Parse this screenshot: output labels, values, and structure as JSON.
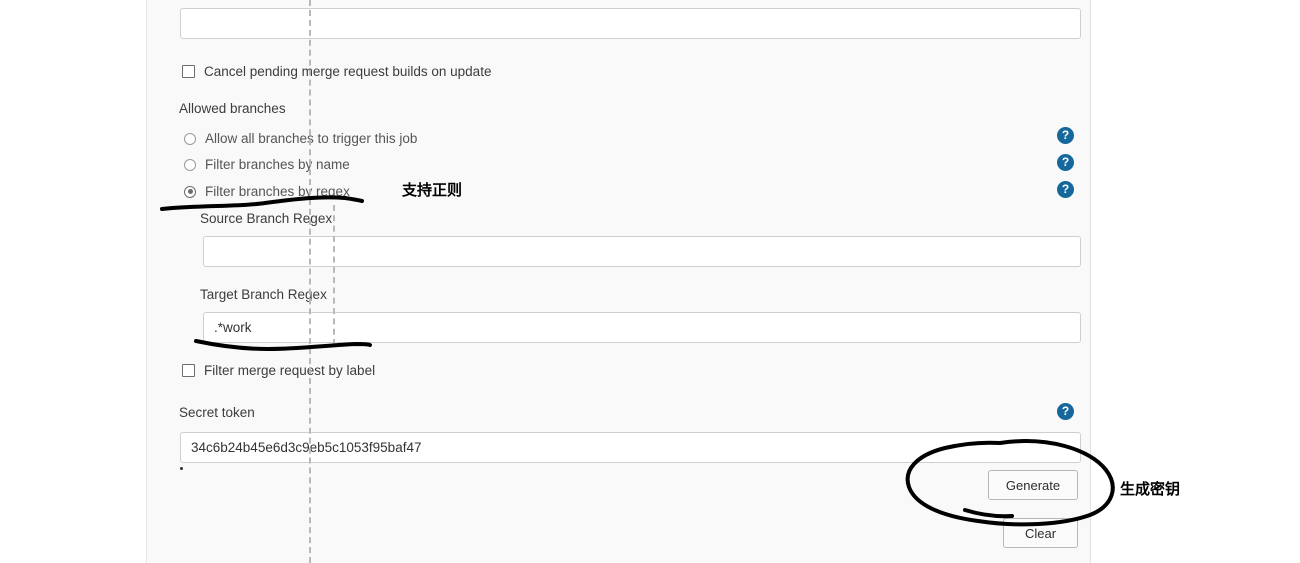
{
  "panel": {
    "top_input": {
      "value": "",
      "placeholder": ""
    },
    "cancel_pending": {
      "label": "Cancel pending merge request builds on update",
      "checked": false
    },
    "allowed_branches": {
      "title": "Allowed branches",
      "options": [
        {
          "label": "Allow all branches to trigger this job",
          "selected": false
        },
        {
          "label": "Filter branches by name",
          "selected": false
        },
        {
          "label": "Filter branches by regex",
          "selected": true
        }
      ]
    },
    "source_branch_regex": {
      "label": "Source Branch Regex",
      "value": "",
      "placeholder": ""
    },
    "target_branch_regex": {
      "label": "Target Branch Regex",
      "value": ".*work",
      "placeholder": ""
    },
    "filter_by_label": {
      "label": "Filter merge request by label",
      "checked": false
    },
    "secret_token": {
      "title": "Secret token",
      "value": "34c6b24b45e6d3c9eb5c1053f95baf47",
      "placeholder": ""
    },
    "buttons": {
      "generate": "Generate",
      "clear": "Clear"
    },
    "help_icons": {
      "glyph": "?",
      "name": "help-icon",
      "color": "#15679c",
      "count": 4
    }
  },
  "annotations": {
    "regex_note": "支持正则",
    "generate_key_note": "生成密钥",
    "ink_color": "#000000"
  },
  "colors": {
    "panel_background": "#f9f9f9",
    "page_background": "#ffffff",
    "input_background": "#ffffff",
    "input_border": "#cfcfcf",
    "text": "#3c3c3c",
    "muted_text": "#555555",
    "help_blue": "#15679c"
  }
}
